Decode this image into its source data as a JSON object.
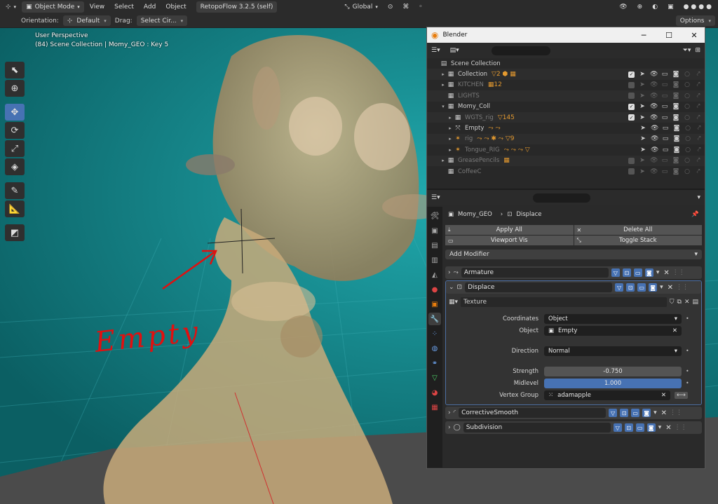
{
  "header": {
    "mode": "Object Mode",
    "menus": [
      "View",
      "Select",
      "Add",
      "Object"
    ],
    "addon": "RetopoFlow 3.2.5 (self)",
    "transform_orientation": "Global"
  },
  "toolsettings": {
    "orientation_label": "Orientation:",
    "orientation_value": "Default",
    "drag_label": "Drag:",
    "drag_value": "Select Cir...",
    "options": "Options"
  },
  "viewport": {
    "perspective": "User Perspective",
    "info": "(84) Scene Collection | Momy_GEO : Key 5",
    "annotation": "Empty",
    "colors": {
      "background": "#12868a",
      "floor": "#4b4b4b",
      "body": "#b89a6c",
      "annotation": "#e01010"
    }
  },
  "window": {
    "title": "Blender",
    "outliner": {
      "search_placeholder": "",
      "rows": [
        {
          "indent": 0,
          "arrow": "",
          "icon": "scene",
          "label": "Scene Collection",
          "extra": "",
          "dim": false,
          "controls": false
        },
        {
          "indent": 1,
          "arrow": "▸",
          "icon": "collection",
          "label": "Collection",
          "extra": "▽2 ⬢ ▦",
          "dim": false,
          "controls": true,
          "checked": true
        },
        {
          "indent": 1,
          "arrow": "▸",
          "icon": "collection",
          "label": "KITCHEN",
          "extra": "▦12",
          "dim": true,
          "controls": true,
          "checked": false
        },
        {
          "indent": 1,
          "arrow": "",
          "icon": "collection",
          "label": "LIGHTS",
          "extra": "",
          "dim": true,
          "controls": true,
          "checked": false
        },
        {
          "indent": 1,
          "arrow": "▾",
          "icon": "collection",
          "label": "Momy_Coll",
          "extra": "",
          "dim": false,
          "controls": true,
          "checked": true
        },
        {
          "indent": 2,
          "arrow": "▸",
          "icon": "collection",
          "label": "WGTS_rig",
          "extra": "▽145",
          "dim": true,
          "controls": true,
          "checked": true
        },
        {
          "indent": 2,
          "arrow": "▸",
          "icon": "empty",
          "label": "Empty",
          "extra": "⤳ ⤳",
          "dim": false,
          "controls": true,
          "checked": null
        },
        {
          "indent": 2,
          "arrow": "▸",
          "icon": "armature",
          "label": "rig",
          "extra": "⤳ ⤳ ✱ ⤳ ▽9",
          "dim": true,
          "controls": true,
          "checked": null
        },
        {
          "indent": 2,
          "arrow": "▸",
          "icon": "armature",
          "label": "Tongue_RIG",
          "extra": "⤳ ⤳ ⤳ ▽",
          "dim": true,
          "controls": true,
          "checked": null
        },
        {
          "indent": 1,
          "arrow": "▸",
          "icon": "collection",
          "label": "GreasePencils",
          "extra": "▦",
          "dim": true,
          "controls": true,
          "checked": false
        },
        {
          "indent": 1,
          "arrow": "",
          "icon": "collection",
          "label": "CoffeeC",
          "extra": "",
          "dim": true,
          "controls": true,
          "checked": false
        }
      ]
    },
    "properties": {
      "breadcrumb_object": "Momy_GEO",
      "breadcrumb_modifier": "Displace",
      "apply_all": "Apply All",
      "delete_all": "Delete All",
      "viewport_vis": "Viewport Vis",
      "toggle_stack": "Toggle Stack",
      "add_modifier": "Add Modifier",
      "modifiers": {
        "armature": "Armature",
        "displace": "Displace",
        "corrective": "CorrectiveSmooth",
        "subdivision": "Subdivision"
      },
      "texture": "Texture",
      "fields": {
        "coordinates_label": "Coordinates",
        "coordinates_value": "Object",
        "object_label": "Object",
        "object_value": "Empty",
        "direction_label": "Direction",
        "direction_value": "Normal",
        "strength_label": "Strength",
        "strength_value": "-0.750",
        "midlevel_label": "Midlevel",
        "midlevel_value": "1.000",
        "vertex_group_label": "Vertex Group",
        "vertex_group_value": "adamapple"
      }
    }
  }
}
